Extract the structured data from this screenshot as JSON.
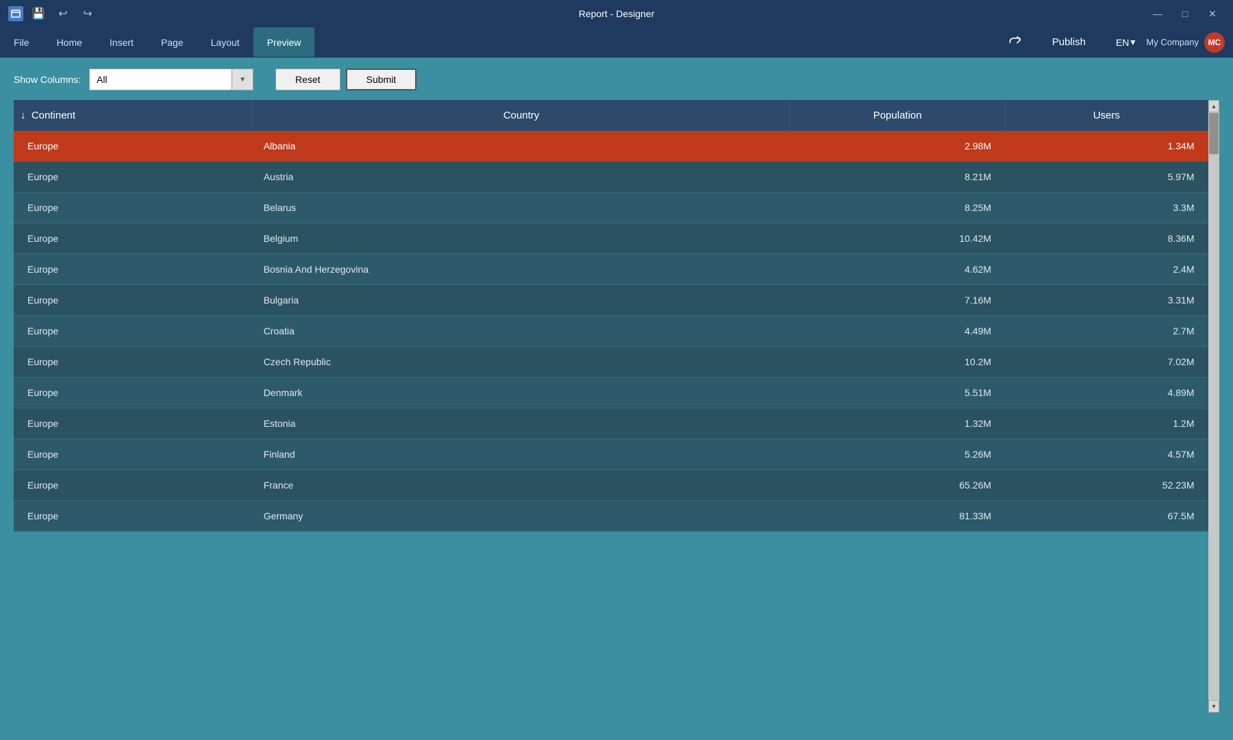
{
  "titleBar": {
    "title": "Report - Designer",
    "saveIcon": "💾",
    "undoIcon": "↩",
    "redoIcon": "↪",
    "minimizeIcon": "—",
    "maximizeIcon": "□",
    "closeIcon": "✕"
  },
  "menuBar": {
    "items": [
      {
        "label": "File",
        "active": false
      },
      {
        "label": "Home",
        "active": false
      },
      {
        "label": "Insert",
        "active": false
      },
      {
        "label": "Page",
        "active": false
      },
      {
        "label": "Layout",
        "active": false
      },
      {
        "label": "Preview",
        "active": true
      }
    ],
    "publishLabel": "Publish",
    "langLabel": "EN",
    "langChevron": "▾",
    "companyLabel": "My Company",
    "avatarLabel": "MC"
  },
  "filterBar": {
    "showColumnsLabel": "Show Columns:",
    "selectValue": "All",
    "resetLabel": "Reset",
    "submitLabel": "Submit"
  },
  "table": {
    "columns": [
      {
        "label": "Continent",
        "sort": true
      },
      {
        "label": "Country",
        "sort": false
      },
      {
        "label": "Population",
        "sort": false
      },
      {
        "label": "Users",
        "sort": false
      }
    ],
    "rows": [
      {
        "continent": "Europe",
        "country": "Albania",
        "population": "2.98M",
        "users": "1.34M",
        "highlighted": true
      },
      {
        "continent": "Europe",
        "country": "Austria",
        "population": "8.21M",
        "users": "5.97M",
        "highlighted": false
      },
      {
        "continent": "Europe",
        "country": "Belarus",
        "population": "8.25M",
        "users": "3.3M",
        "highlighted": false
      },
      {
        "continent": "Europe",
        "country": "Belgium",
        "population": "10.42M",
        "users": "8.36M",
        "highlighted": false
      },
      {
        "continent": "Europe",
        "country": "Bosnia And Herzegovina",
        "population": "4.62M",
        "users": "2.4M",
        "highlighted": false
      },
      {
        "continent": "Europe",
        "country": "Bulgaria",
        "population": "7.16M",
        "users": "3.31M",
        "highlighted": false
      },
      {
        "continent": "Europe",
        "country": "Croatia",
        "population": "4.49M",
        "users": "2.7M",
        "highlighted": false
      },
      {
        "continent": "Europe",
        "country": "Czech Republic",
        "population": "10.2M",
        "users": "7.02M",
        "highlighted": false
      },
      {
        "continent": "Europe",
        "country": "Denmark",
        "population": "5.51M",
        "users": "4.89M",
        "highlighted": false
      },
      {
        "continent": "Europe",
        "country": "Estonia",
        "population": "1.32M",
        "users": "1.2M",
        "highlighted": false
      },
      {
        "continent": "Europe",
        "country": "Finland",
        "population": "5.26M",
        "users": "4.57M",
        "highlighted": false
      },
      {
        "continent": "Europe",
        "country": "France",
        "population": "65.26M",
        "users": "52.23M",
        "highlighted": false
      },
      {
        "continent": "Europe",
        "country": "Germany",
        "population": "81.33M",
        "users": "67.5M",
        "highlighted": false
      }
    ]
  }
}
